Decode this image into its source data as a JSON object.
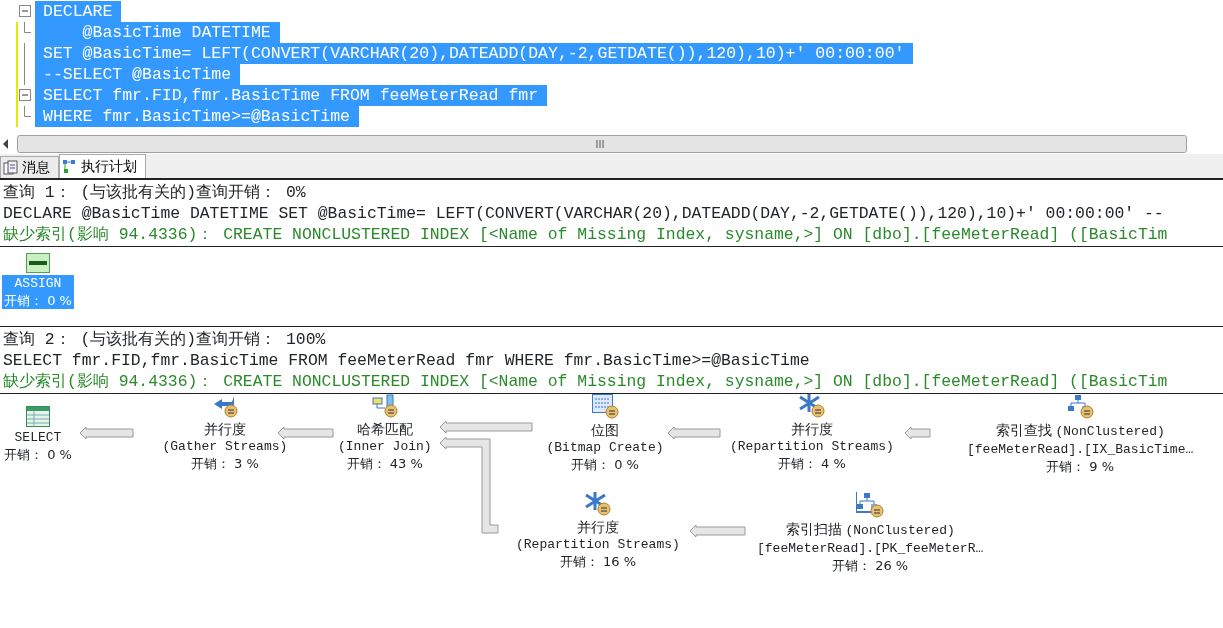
{
  "editor": {
    "lines": [
      {
        "text": "DECLARE",
        "selected": true,
        "collapsible": true,
        "modified": false
      },
      {
        "text": "    @BasicTime DATETIME",
        "selected": true,
        "collapsible": false,
        "block_end": true,
        "modified": true
      },
      {
        "text": "SET @BasicTime= LEFT(CONVERT(VARCHAR(20),DATEADD(DAY,-2,GETDATE()),120),10)+' 00:00:00'",
        "selected": true,
        "collapsible": false,
        "block_end": false,
        "modified": true
      },
      {
        "text": "--SELECT @BasicTime",
        "selected": true,
        "collapsible": false,
        "block_end": false,
        "modified": true
      },
      {
        "text": "SELECT fmr.FID,fmr.BasicTime FROM feeMeterRead fmr",
        "selected": true,
        "collapsible": true,
        "modified": true
      },
      {
        "text": "WHERE fmr.BasicTime>=@BasicTime",
        "selected": true,
        "collapsible": false,
        "block_end": true,
        "modified": true
      }
    ]
  },
  "tabs": [
    {
      "label": "消息",
      "selected": false,
      "kind": "messages"
    },
    {
      "label": "执行计划",
      "selected": true,
      "kind": "plan"
    }
  ],
  "queries": [
    {
      "header": "查询 1： (与该批有关的)查询开销： 0%",
      "sql": "DECLARE @BasicTime DATETIME SET @BasicTime= LEFT(CONVERT(VARCHAR(20),DATEADD(DAY,-2,GETDATE()),120),10)+' 00:00:00' --",
      "missing_index": "缺少索引(影响 94.4336)： CREATE NONCLUSTERED INDEX [<Name of Missing Index, sysname,>] ON [dbo].[feeMeterRead] ([BasicTim",
      "nodes": [
        {
          "kind": "tsql",
          "name": "ASSIGN",
          "cost": "开销： 0 %",
          "selected": true
        }
      ]
    },
    {
      "header": "查询 2： (与该批有关的)查询开销： 100%",
      "sql": "SELECT fmr.FID,fmr.BasicTime FROM feeMeterRead fmr WHERE fmr.BasicTime>=@BasicTime",
      "missing_index": "缺少索引(影响 94.4336)： CREATE NONCLUSTERED INDEX [<Name of Missing Index, sysname,>] ON [dbo].[feeMeterRead] ([BasicTim",
      "nodes": [
        {
          "kind": "select",
          "name": "SELECT",
          "cost": "开销： 0 %",
          "selected": false
        },
        {
          "kind": "gather",
          "name": "并行度",
          "subtitle": "(Gather Streams)",
          "cost": "开销： 3 %",
          "selected": false
        },
        {
          "kind": "hash",
          "name": "哈希匹配",
          "subtitle": "(Inner Join)",
          "cost": "开销： 43 %",
          "selected": false
        },
        {
          "kind": "bitmap",
          "name": "位图",
          "subtitle": "(Bitmap Create)",
          "cost": "开销： 0 %",
          "selected": false
        },
        {
          "kind": "repartition",
          "name": "并行度",
          "subtitle": "(Repartition Streams)",
          "cost": "开销： 4 %",
          "selected": false
        },
        {
          "kind": "seek",
          "name": "索引查找",
          "detail": "(NonClustered)",
          "subtitle": "[feeMeterRead].[IX_BasicTime…",
          "cost": "开销： 9 %",
          "selected": false
        },
        {
          "kind": "repartition",
          "name": "并行度",
          "subtitle": "(Repartition Streams)",
          "cost": "开销： 16 %",
          "selected": false
        },
        {
          "kind": "scan",
          "name": "索引扫描",
          "detail": "(NonClustered)",
          "subtitle": "[feeMeterRead].[PK_feeMeterR…",
          "cost": "开销： 26 %",
          "selected": false
        }
      ]
    }
  ]
}
